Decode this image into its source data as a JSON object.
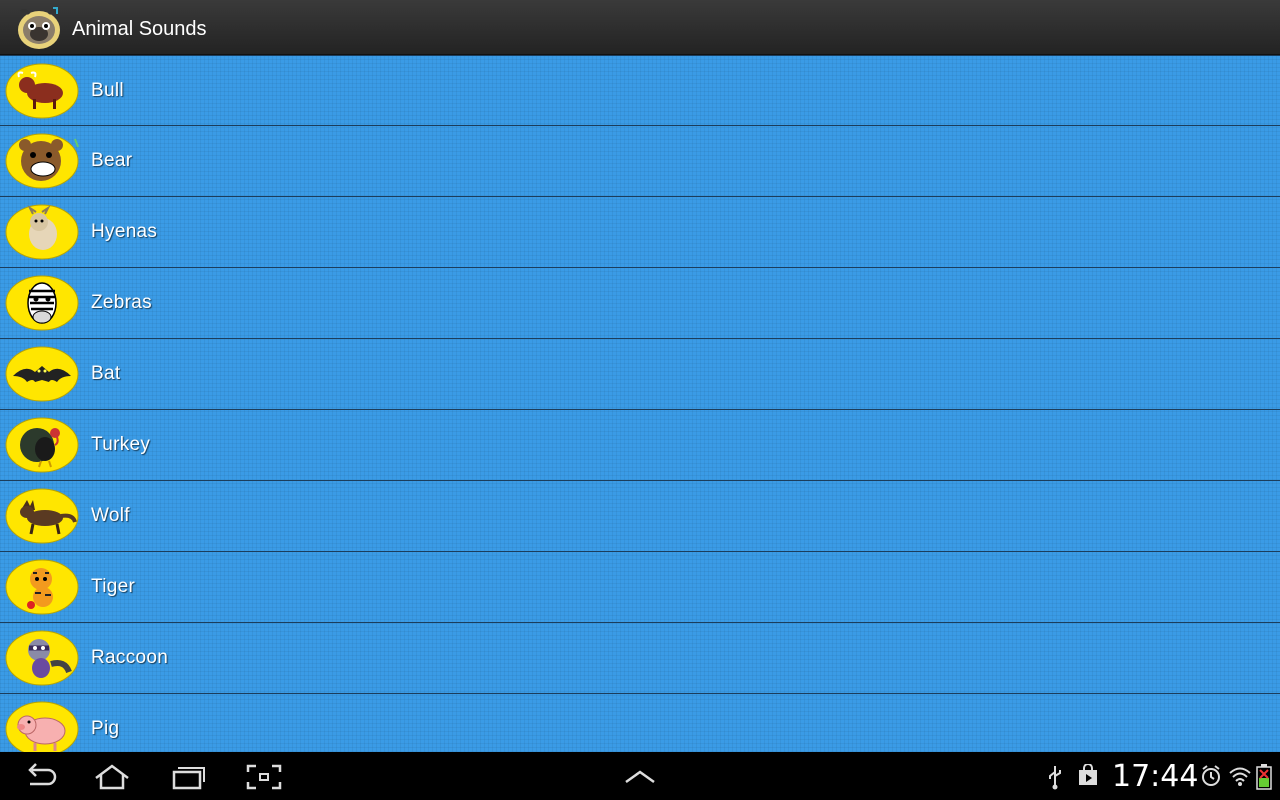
{
  "app": {
    "title": "Animal Sounds",
    "icon": "pug-app-icon"
  },
  "animals": [
    {
      "label": "Bull",
      "icon": "bull-icon"
    },
    {
      "label": "Bear",
      "icon": "bear-icon"
    },
    {
      "label": "Hyenas",
      "icon": "hyena-icon"
    },
    {
      "label": "Zebras",
      "icon": "zebra-icon"
    },
    {
      "label": "Bat",
      "icon": "bat-icon"
    },
    {
      "label": "Turkey",
      "icon": "turkey-icon"
    },
    {
      "label": "Wolf",
      "icon": "wolf-icon"
    },
    {
      "label": "Tiger",
      "icon": "tiger-icon"
    },
    {
      "label": "Raccoon",
      "icon": "raccoon-icon"
    },
    {
      "label": "Pig",
      "icon": "pig-icon"
    }
  ],
  "status": {
    "time": "17:44",
    "icons": [
      "usb-icon",
      "play-store-icon",
      "alarm-icon",
      "wifi-icon",
      "battery-icon"
    ]
  },
  "nav": {
    "buttons": [
      "back-icon",
      "home-icon",
      "recent-apps-icon",
      "screenshot-icon",
      "chevron-up-icon"
    ]
  },
  "colors": {
    "list_bg": "#3a9be6",
    "badge": "#ffe600",
    "action_bar": "#2c2c2c"
  }
}
